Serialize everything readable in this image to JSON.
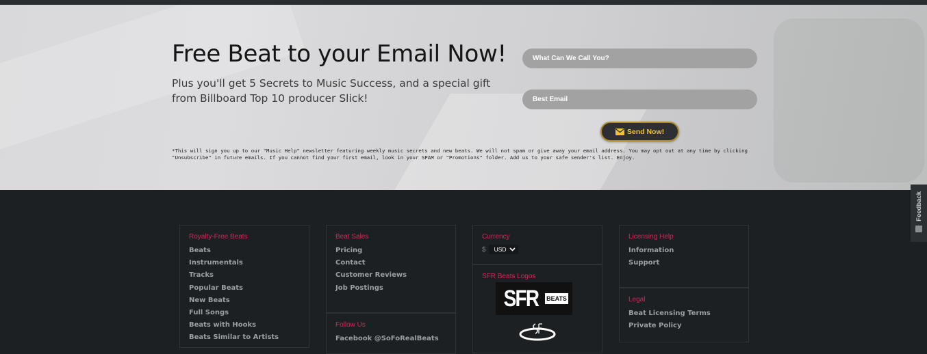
{
  "hero": {
    "headline": "Free Beat to your Email Now!",
    "subline": "Plus you'll get 5 Secrets to Music Success, and a special gift from Billboard Top 10 producer Slick!",
    "name_placeholder": "What Can We Call You?",
    "email_placeholder": "Best Email",
    "send_label": "Send Now!",
    "disclaimer": "*This will sign you up to our \"Music Help\" newsletter featuring weekly music secrets and new beats. We will not spam or give away your email address. You may opt out at any time by clicking \"Unsubscribe\" in future emails. If you cannot find your first email, look in your SPAM or \"Promotions\" folder. Add us to your safe sender's list. Enjoy."
  },
  "footer": {
    "royalty": {
      "heading": "Royalty-Free Beats",
      "links": [
        "Beats",
        "Instrumentals",
        "Tracks",
        "Popular Beats",
        "New Beats",
        "Full Songs",
        "Beats with Hooks",
        "Beats Similar to Artists"
      ]
    },
    "sales": {
      "heading": "Beat Sales",
      "links": [
        "Pricing",
        "Contact",
        "Customer Reviews",
        "Job Postings"
      ]
    },
    "follow": {
      "heading": "Follow Us",
      "links": [
        "Facebook @SoFoRealBeats"
      ]
    },
    "currency": {
      "heading": "Currency",
      "symbol": "$",
      "selected": "USD"
    },
    "logos": {
      "heading": "SFR Beats Logos",
      "logo_text": "SFR",
      "logo_mark": "BEATS"
    },
    "licensing": {
      "heading": "Licensing Help",
      "links": [
        "Information",
        "Support"
      ]
    },
    "legal": {
      "heading": "Legal",
      "links": [
        "Beat Licensing Terms",
        "Private Policy"
      ]
    }
  },
  "feedback": {
    "label": "Feedback"
  },
  "colors": {
    "accent_pink": "#d0295a",
    "button_gold": "#f2c230",
    "footer_bg": "#1d2022"
  }
}
